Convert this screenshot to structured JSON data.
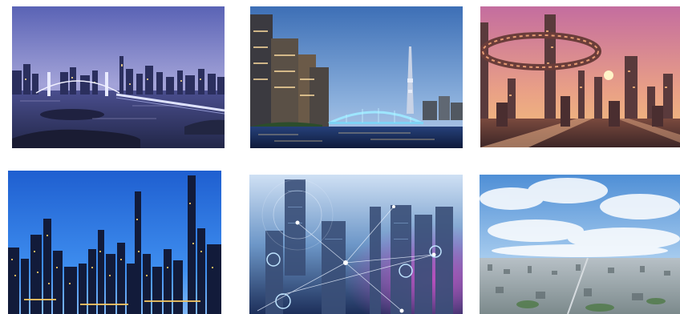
{
  "gallery": {
    "items": [
      {
        "id": "t1",
        "caption": ""
      },
      {
        "id": "t2",
        "caption": ""
      },
      {
        "id": "t3",
        "caption": ""
      },
      {
        "id": "t4",
        "caption": ""
      },
      {
        "id": "t5",
        "caption": ""
      },
      {
        "id": "t6",
        "caption": ""
      }
    ]
  },
  "colors": {
    "page_background": "#ffffff",
    "dusk_sky_top": "#5b67b8",
    "dusk_sky_bottom": "#a7a6d9",
    "day_sky_top": "#3f72b8",
    "day_sky_bottom": "#a9c6e6",
    "sunset_sky_top": "#c76aa0",
    "sunset_sky_bottom": "#f2b48e",
    "night_blue_sky": "#1b66d6",
    "tech_blue": "#3b7fd0",
    "aerial_sky": "#6ea9dd"
  }
}
